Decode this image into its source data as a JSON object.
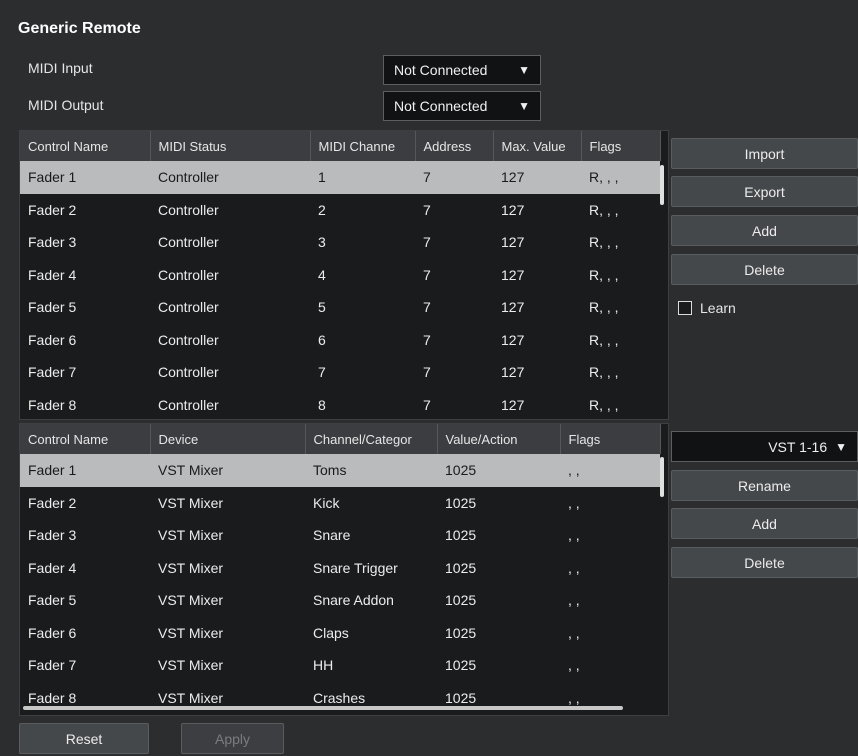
{
  "title": "Generic Remote",
  "midi_input": {
    "label": "MIDI Input",
    "value": "Not Connected"
  },
  "midi_output": {
    "label": "MIDI Output",
    "value": "Not Connected"
  },
  "controls_table": {
    "columns": [
      "Control Name",
      "MIDI Status",
      "MIDI Channe",
      "Address",
      "Max. Value",
      "Flags"
    ],
    "rows": [
      [
        "Fader 1",
        "Controller",
        "1",
        "7",
        "127",
        "R, , ,"
      ],
      [
        "Fader 2",
        "Controller",
        "2",
        "7",
        "127",
        "R, , ,"
      ],
      [
        "Fader 3",
        "Controller",
        "3",
        "7",
        "127",
        "R, , ,"
      ],
      [
        "Fader 4",
        "Controller",
        "4",
        "7",
        "127",
        "R, , ,"
      ],
      [
        "Fader 5",
        "Controller",
        "5",
        "7",
        "127",
        "R, , ,"
      ],
      [
        "Fader 6",
        "Controller",
        "6",
        "7",
        "127",
        "R, , ,"
      ],
      [
        "Fader 7",
        "Controller",
        "7",
        "7",
        "127",
        "R, , ,"
      ],
      [
        "Fader 8",
        "Controller",
        "8",
        "7",
        "127",
        "R, , ,"
      ]
    ],
    "selected_row": 0
  },
  "controls_buttons": {
    "import": "Import",
    "export": "Export",
    "add": "Add",
    "delete": "Delete",
    "learn": "Learn"
  },
  "bank": {
    "value": "VST 1-16"
  },
  "assign_table": {
    "columns": [
      "Control Name",
      "Device",
      "Channel/Categor",
      "Value/Action",
      "Flags"
    ],
    "rows": [
      [
        "Fader 1",
        "VST Mixer",
        "Toms",
        "1025",
        ", ,"
      ],
      [
        "Fader 2",
        "VST Mixer",
        "Kick",
        "1025",
        ", ,"
      ],
      [
        "Fader 3",
        "VST Mixer",
        "Snare",
        "1025",
        ", ,"
      ],
      [
        "Fader 4",
        "VST Mixer",
        "Snare Trigger",
        "1025",
        ", ,"
      ],
      [
        "Fader 5",
        "VST Mixer",
        "Snare Addon",
        "1025",
        ", ,"
      ],
      [
        "Fader 6",
        "VST Mixer",
        "Claps",
        "1025",
        ", ,"
      ],
      [
        "Fader 7",
        "VST Mixer",
        "HH",
        "1025",
        ", ,"
      ],
      [
        "Fader 8",
        "VST Mixer",
        "Crashes",
        "1025",
        ", ,"
      ]
    ],
    "selected_row": 0
  },
  "assign_buttons": {
    "rename": "Rename",
    "add": "Add",
    "delete": "Delete"
  },
  "footer": {
    "reset": "Reset",
    "apply": "Apply"
  }
}
